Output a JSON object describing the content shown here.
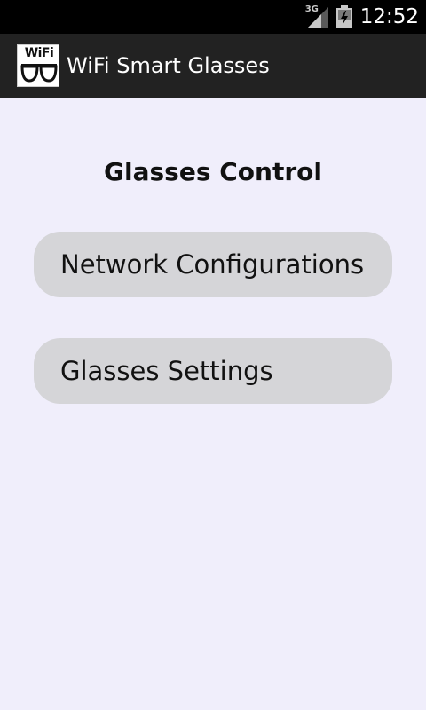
{
  "status_bar": {
    "network_type": "3G",
    "time": "12:52"
  },
  "action_bar": {
    "app_icon_label": "WiFi",
    "title": "WiFi Smart Glasses"
  },
  "main": {
    "heading": "Glasses Control",
    "buttons": [
      {
        "label": "Network Configurations"
      },
      {
        "label": "Glasses Settings"
      }
    ]
  },
  "icons": {
    "signal": "signal-strength-icon",
    "battery": "battery-charging-icon",
    "app": "glasses-icon"
  },
  "colors": {
    "status_bar": "#000000",
    "action_bar": "#222222",
    "background": "#f0eefb",
    "button": "#d5d5d8"
  }
}
